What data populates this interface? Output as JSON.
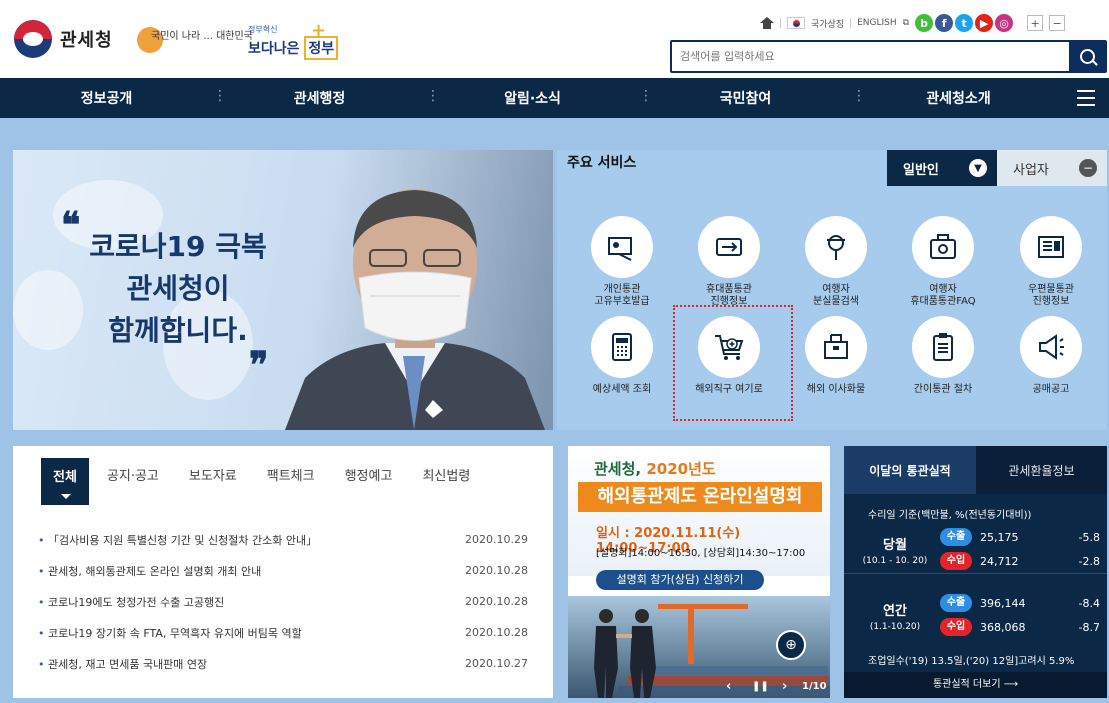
{
  "header": {
    "logo_text": "관세청",
    "slogan1": "국민이 나라 ... 대한민국",
    "slogan2_top": "정부혁신",
    "slogan2_main_prefix": "보다나은",
    "slogan2_main_box": "정부",
    "utility": {
      "national_symbol": "국가상징",
      "english": "ENGLISH",
      "zoom_in": "+",
      "zoom_out": "−"
    },
    "search_placeholder": "검색어를 입력하세요"
  },
  "gnb": {
    "items": [
      "정보공개",
      "관세행정",
      "알림·소식",
      "국민참여",
      "관세청소개"
    ]
  },
  "banner": {
    "line1": "코로나19 극복",
    "line2": "관세청이",
    "line3": "함께합니다.",
    "quote_open": "❝",
    "quote_close": "❞"
  },
  "services": {
    "title": "주요 서비스",
    "tab_general": "일반인",
    "tab_business": "사업자",
    "items": [
      {
        "label1": "개인통관",
        "label2": "고유부호발급"
      },
      {
        "label1": "휴대품통관",
        "label2": "진행정보"
      },
      {
        "label1": "여행자",
        "label2": "분실물검색"
      },
      {
        "label1": "여행자",
        "label2": "휴대품통관FAQ"
      },
      {
        "label1": "우편물통관",
        "label2": "진행정보"
      },
      {
        "label1": "예상세액 조회",
        "label2": ""
      },
      {
        "label1": "해외직구 여기로",
        "label2": ""
      },
      {
        "label1": "해외 이사화물",
        "label2": ""
      },
      {
        "label1": "간이통관 절차",
        "label2": ""
      },
      {
        "label1": "공매공고",
        "label2": ""
      }
    ]
  },
  "news": {
    "tabs": [
      "전체",
      "공지·공고",
      "보도자료",
      "팩트체크",
      "행정예고",
      "최신법령"
    ],
    "items": [
      {
        "title": "「검사비용 지원 특별신청 기간 및 신청절차 간소화 안내」",
        "date": "2020.10.29"
      },
      {
        "title": "관세청, 해외통관제도 온라인 설명회 개최 안내",
        "date": "2020.10.28"
      },
      {
        "title": "코로나19에도 청정가전 수출 고공행진",
        "date": "2020.10.28"
      },
      {
        "title": "코로나19 장기화 속 FTA, 무역흑자 유지에 버팀목 역할",
        "date": "2020.10.28"
      },
      {
        "title": "관세청, 재고 면세품 국내판매 연장",
        "date": "2020.10.27"
      }
    ]
  },
  "promo": {
    "title_a": "관세청, ",
    "title_b": "2020년도",
    "headline": "해외통관제도 온라인설명회",
    "date": "일시 : 2020.11.11(수) 14:00~17:00",
    "detail": "[설명회]14:00~16:30, [상담회]14:30~17:00",
    "button": "설명회 참가(상담) 신청하기",
    "prev": "‹",
    "pause": "❚❚",
    "next": "›",
    "page": "1/10"
  },
  "stats": {
    "tab1": "이달의 통관실적",
    "tab2": "관세환율정보",
    "note": "수리일 기준(백만불, %(전년동기대비))",
    "month": {
      "label": "당월",
      "range": "(10.1 - 10. 20)",
      "export_label": "수출",
      "export_val": "25,175",
      "export_pct": "-5.8",
      "import_label": "수입",
      "import_val": "24,712",
      "import_pct": "-2.8"
    },
    "year": {
      "label": "연간",
      "range": "(1.1-10.20)",
      "export_label": "수출",
      "export_val": "396,144",
      "export_pct": "-8.4",
      "import_label": "수입",
      "import_val": "368,068",
      "import_pct": "-8.7"
    },
    "footnote": "조업일수('19) 13.5일,('20) 12일]고려시 5.9%",
    "more": "통관실적 더보기 ⟶"
  },
  "colors": {
    "navy": "#0b2847",
    "bg_blue": "#9fc3e6",
    "accent_orange": "#ee8a1c",
    "export_blue": "#2e8ee6",
    "import_red": "#e3242b"
  }
}
